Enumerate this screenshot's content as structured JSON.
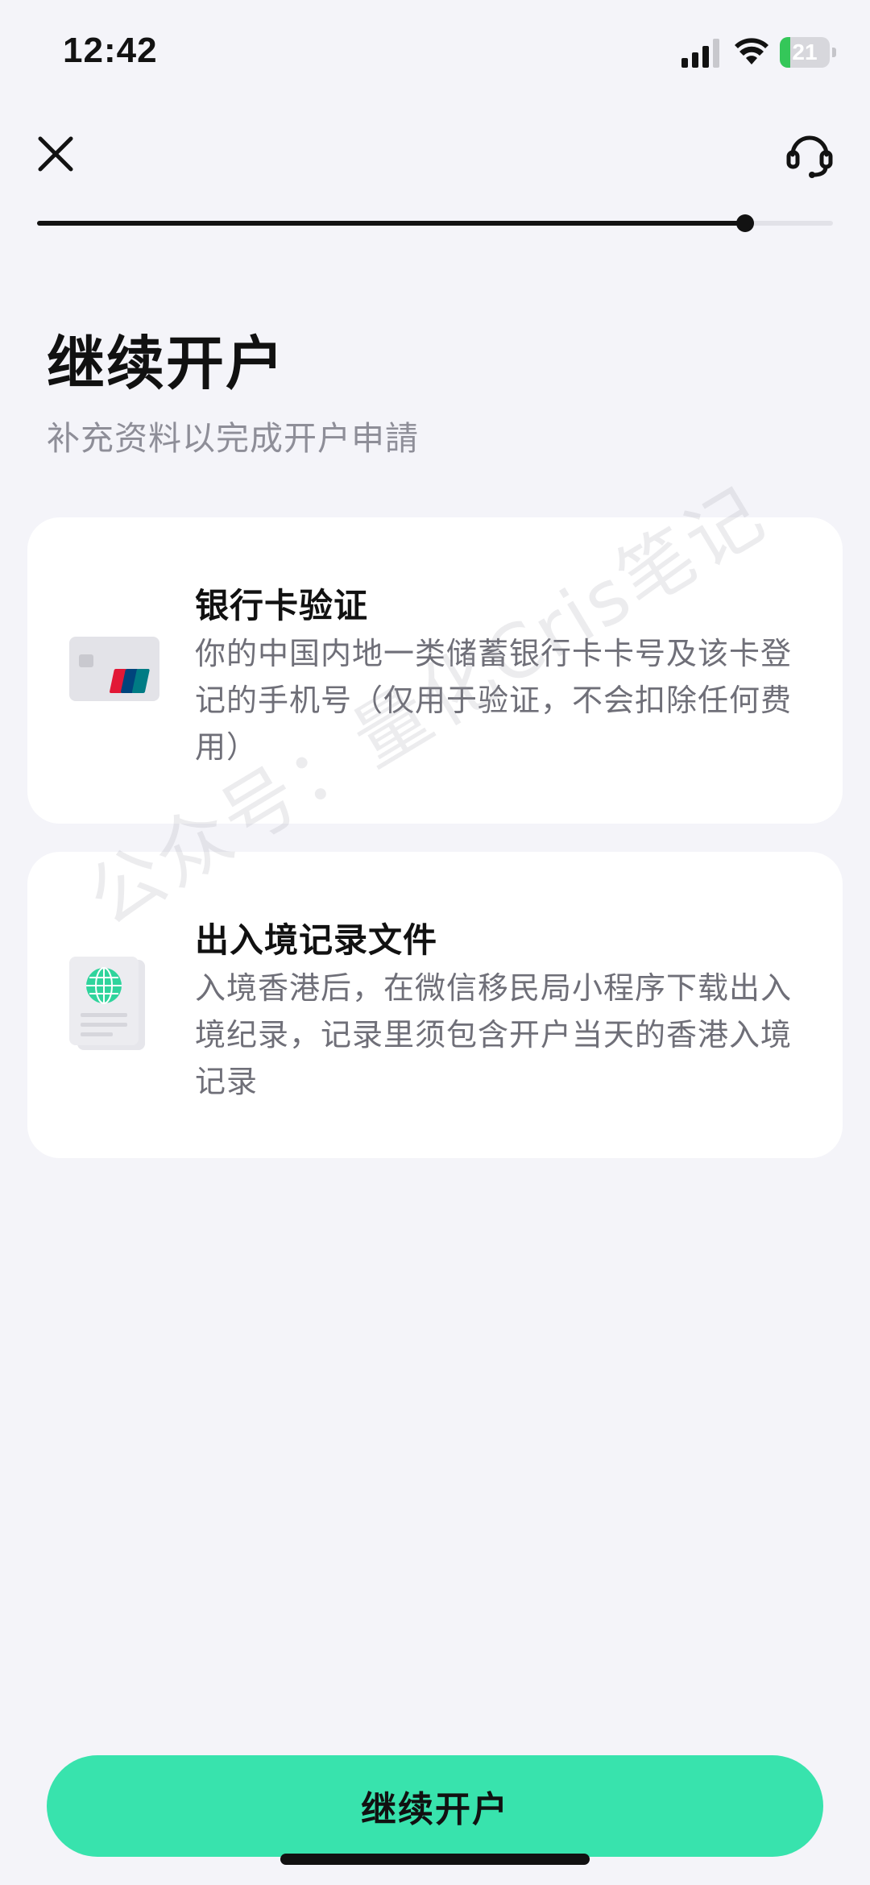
{
  "status_bar": {
    "time": "12:42",
    "battery_text": "21",
    "battery_level": 0.21,
    "battery_color": "#34c759"
  },
  "header": {
    "close_icon": "close-icon",
    "support_icon": "headset-icon"
  },
  "progress": {
    "value": 0.89
  },
  "page": {
    "title": "继续开户",
    "subtitle": "补充资料以完成开户申請"
  },
  "cards": [
    {
      "icon": "bank-card-icon",
      "title": "银行卡验证",
      "description": "你的中国内地一类储蓄银行卡卡号及该卡登记的手机号（仅用于验证，不会扣除任何费用）"
    },
    {
      "icon": "passport-globe-icon",
      "title": "出入境记录文件",
      "description": "入境香港后，在微信移民局小程序下载出入境纪录，记录里须包含开户当天的香港入境记录"
    }
  ],
  "watermark": "公众号：量化Cris笔记",
  "footer": {
    "button_label": "继续开户",
    "button_color": "#38e3ad"
  }
}
